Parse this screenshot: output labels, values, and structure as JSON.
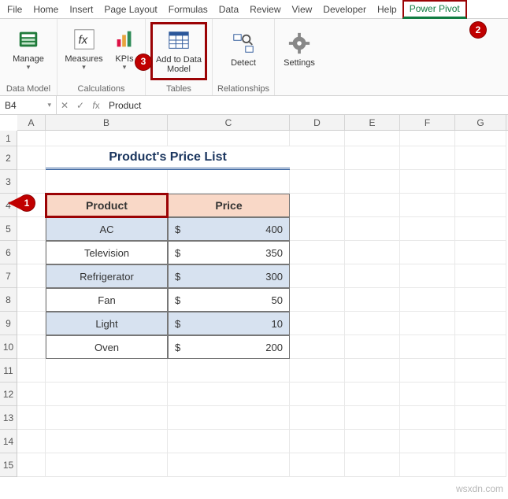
{
  "tabs": [
    "File",
    "Home",
    "Insert",
    "Page Layout",
    "Formulas",
    "Data",
    "Review",
    "View",
    "Developer",
    "Help",
    "Power Pivot"
  ],
  "activeTab": "Power Pivot",
  "ribbon": {
    "manage": "Manage",
    "measures": "Measures",
    "kpis": "KPIs",
    "add": "Add to Data Model",
    "detect": "Detect",
    "settings": "Settings",
    "g1": "Data Model",
    "g2": "Calculations",
    "g3": "Tables",
    "g4": "Relationships"
  },
  "callouts": {
    "c1": "1",
    "c2": "2",
    "c3": "3"
  },
  "namebox": "B4",
  "formula": "Product",
  "cols": [
    "A",
    "B",
    "C",
    "D",
    "E",
    "F",
    "G"
  ],
  "rows": [
    "1",
    "2",
    "3",
    "4",
    "5",
    "6",
    "7",
    "8",
    "9",
    "10",
    "11",
    "12",
    "13",
    "14",
    "15"
  ],
  "title": "Product's Price List",
  "headers": {
    "b": "Product",
    "c": "Price"
  },
  "curSym": "$",
  "data": [
    {
      "p": "AC",
      "v": "400",
      "band": true
    },
    {
      "p": "Television",
      "v": "350",
      "band": false
    },
    {
      "p": "Refrigerator",
      "v": "300",
      "band": true
    },
    {
      "p": "Fan",
      "v": "50",
      "band": false
    },
    {
      "p": "Light",
      "v": "10",
      "band": true
    },
    {
      "p": "Oven",
      "v": "200",
      "band": false
    }
  ],
  "chart_data": {
    "type": "table",
    "title": "Product's Price List",
    "columns": [
      "Product",
      "Price"
    ],
    "rows": [
      [
        "AC",
        400
      ],
      [
        "Television",
        350
      ],
      [
        "Refrigerator",
        300
      ],
      [
        "Fan",
        50
      ],
      [
        "Light",
        10
      ],
      [
        "Oven",
        200
      ]
    ]
  },
  "watermark": "wsxdn.com"
}
